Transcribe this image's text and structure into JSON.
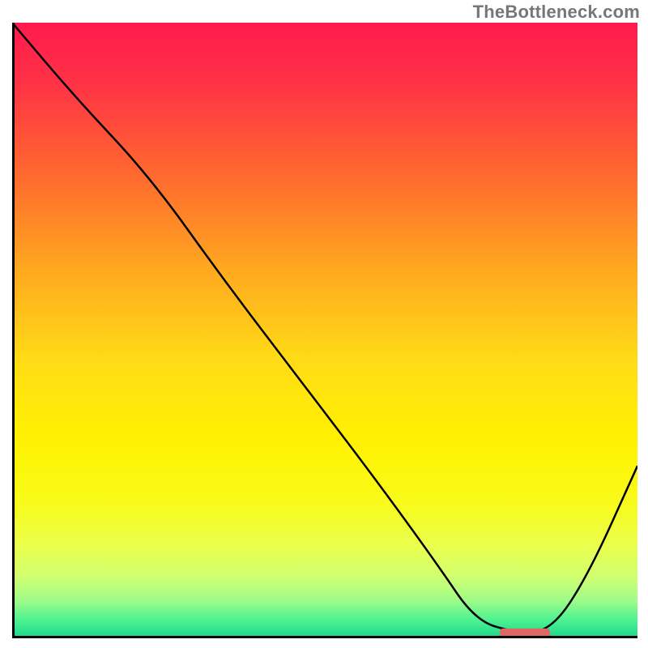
{
  "watermark": "TheBottleneck.com",
  "chart_data": {
    "type": "line",
    "title": "",
    "xlabel": "",
    "ylabel": "",
    "ylim": [
      0,
      100
    ],
    "xlim": [
      0,
      100
    ],
    "background_gradient": {
      "stops": [
        {
          "offset": 0.0,
          "color": "#ff1a4d"
        },
        {
          "offset": 0.1,
          "color": "#ff3345"
        },
        {
          "offset": 0.25,
          "color": "#ff6a2e"
        },
        {
          "offset": 0.4,
          "color": "#ffa81f"
        },
        {
          "offset": 0.55,
          "color": "#ffdc15"
        },
        {
          "offset": 0.68,
          "color": "#fff200"
        },
        {
          "offset": 0.78,
          "color": "#f8fb1a"
        },
        {
          "offset": 0.85,
          "color": "#eaff4d"
        },
        {
          "offset": 0.9,
          "color": "#d0ff70"
        },
        {
          "offset": 0.94,
          "color": "#9cfc8a"
        },
        {
          "offset": 0.97,
          "color": "#4ef291"
        },
        {
          "offset": 1.0,
          "color": "#18d88a"
        }
      ]
    },
    "series": [
      {
        "name": "bottleneck-curve",
        "color": "#000000",
        "width": 2.5,
        "x": [
          0,
          10,
          22,
          34,
          46,
          58,
          68,
          74,
          80,
          86,
          92,
          100
        ],
        "y": [
          100,
          88,
          75,
          58,
          42,
          26,
          12,
          3,
          1,
          1,
          10,
          28
        ]
      }
    ],
    "marker": {
      "name": "optimal-range-bar",
      "color": "#e06666",
      "x_start": 78,
      "x_end": 86,
      "y": 0.8,
      "thickness": 1.6
    }
  }
}
